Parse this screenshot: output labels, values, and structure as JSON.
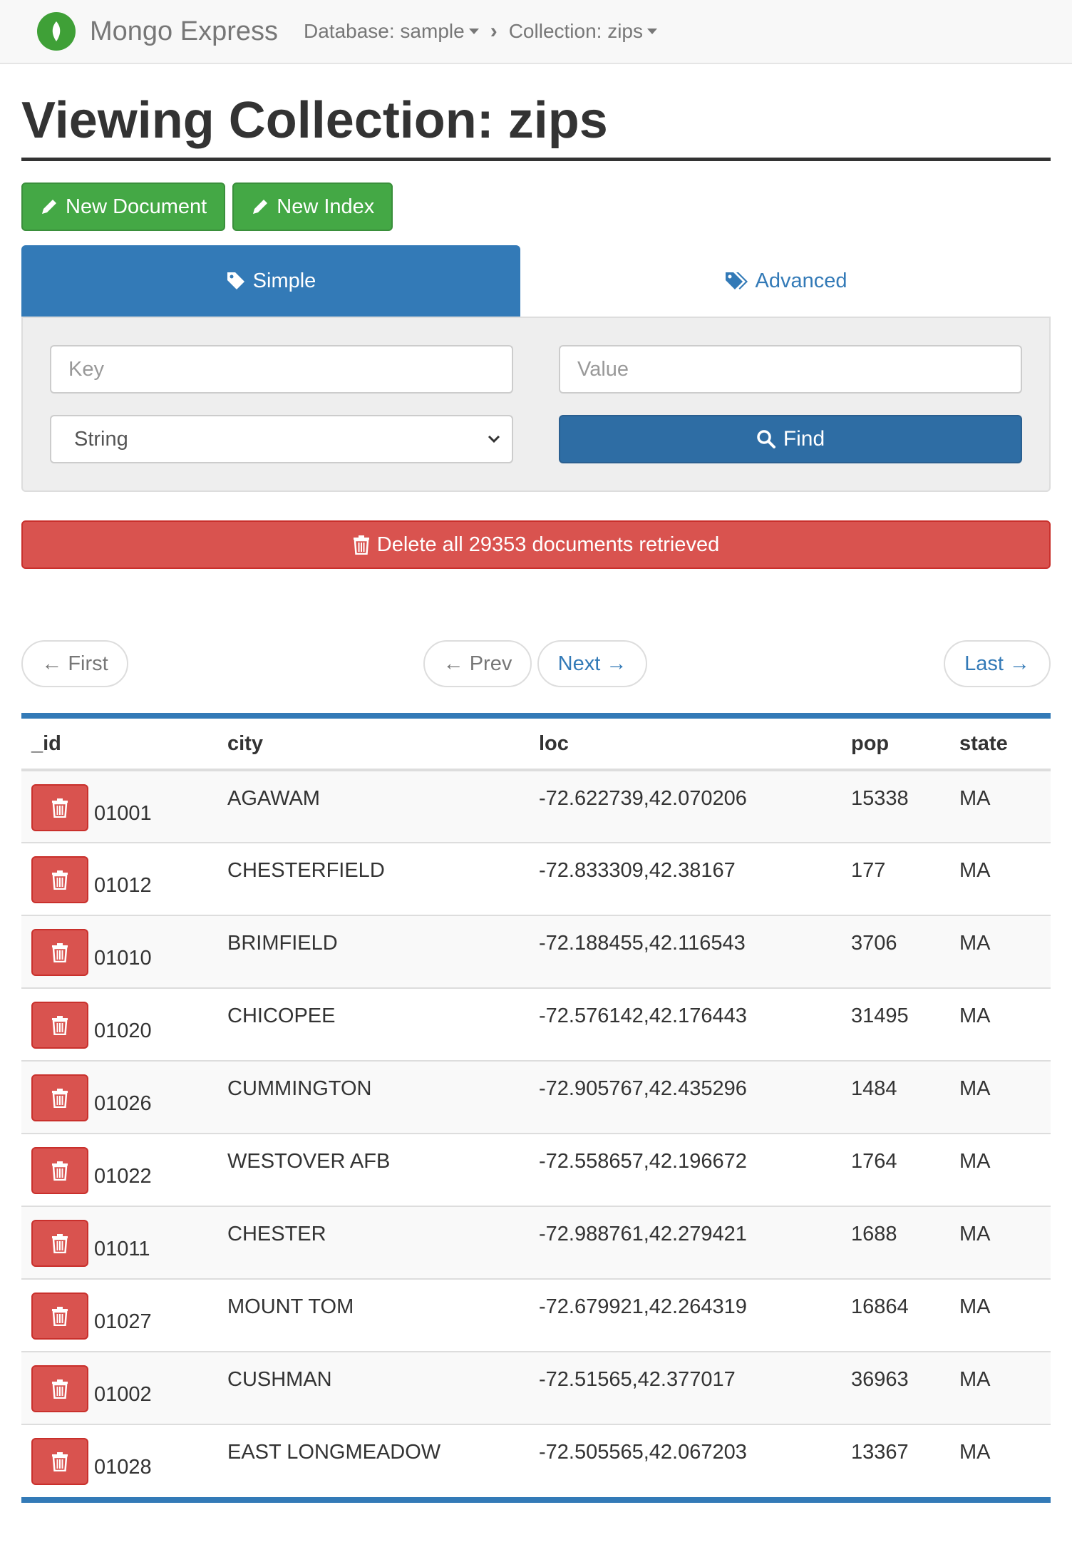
{
  "navbar": {
    "brand": "Mongo Express",
    "database_crumb": "Database: sample",
    "collection_crumb": "Collection: zips"
  },
  "page": {
    "title": "Viewing Collection: zips"
  },
  "actions": {
    "new_document": "New Document",
    "new_index": "New Index"
  },
  "tabs": {
    "simple": "Simple",
    "advanced": "Advanced"
  },
  "query": {
    "key_placeholder": "Key",
    "value_placeholder": "Value",
    "type_selected": "String",
    "find_label": "Find"
  },
  "delete_all_label": "Delete all 29353 documents retrieved",
  "pagination": {
    "first": "← First",
    "prev": "← Prev",
    "next": "Next →",
    "last": "Last →"
  },
  "table": {
    "columns": [
      "_id",
      "city",
      "loc",
      "pop",
      "state"
    ],
    "rows": [
      {
        "id": "01001",
        "city": "AGAWAM",
        "loc": "-72.622739,42.070206",
        "pop": "15338",
        "state": "MA"
      },
      {
        "id": "01012",
        "city": "CHESTERFIELD",
        "loc": "-72.833309,42.38167",
        "pop": "177",
        "state": "MA"
      },
      {
        "id": "01010",
        "city": "BRIMFIELD",
        "loc": "-72.188455,42.116543",
        "pop": "3706",
        "state": "MA"
      },
      {
        "id": "01020",
        "city": "CHICOPEE",
        "loc": "-72.576142,42.176443",
        "pop": "31495",
        "state": "MA"
      },
      {
        "id": "01026",
        "city": "CUMMINGTON",
        "loc": "-72.905767,42.435296",
        "pop": "1484",
        "state": "MA"
      },
      {
        "id": "01022",
        "city": "WESTOVER AFB",
        "loc": "-72.558657,42.196672",
        "pop": "1764",
        "state": "MA"
      },
      {
        "id": "01011",
        "city": "CHESTER",
        "loc": "-72.988761,42.279421",
        "pop": "1688",
        "state": "MA"
      },
      {
        "id": "01027",
        "city": "MOUNT TOM",
        "loc": "-72.679921,42.264319",
        "pop": "16864",
        "state": "MA"
      },
      {
        "id": "01002",
        "city": "CUSHMAN",
        "loc": "-72.51565,42.377017",
        "pop": "36963",
        "state": "MA"
      },
      {
        "id": "01028",
        "city": "EAST LONGMEADOW",
        "loc": "-72.505565,42.067203",
        "pop": "13367",
        "state": "MA"
      }
    ]
  }
}
